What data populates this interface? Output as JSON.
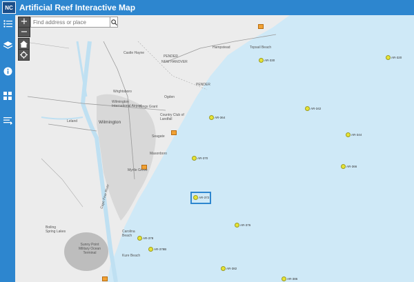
{
  "app": {
    "title": "Artificial Reef Interactive Map",
    "logo_text": "NC"
  },
  "search": {
    "placeholder": "Find address or place"
  },
  "zoom": {
    "in_label": "+",
    "out_label": "−"
  },
  "sidebar": {
    "items": [
      {
        "name": "legend-list-icon"
      },
      {
        "name": "layers-icon"
      },
      {
        "name": "info-icon"
      },
      {
        "name": "basemap-grid-icon"
      },
      {
        "name": "details-list-icon"
      }
    ]
  },
  "places": [
    {
      "label": "Castle Hayne"
    },
    {
      "label": "PENDER"
    },
    {
      "label": "NEW HANOVER"
    },
    {
      "label": "Hampstead"
    },
    {
      "label": "Topsail Beach"
    },
    {
      "label": "PENDER"
    },
    {
      "label": "Wrightsboro"
    },
    {
      "label": "Wilmington International Airport"
    },
    {
      "label": "Kings Grant"
    },
    {
      "label": "Ogden"
    },
    {
      "label": "Country Club of Landfall"
    },
    {
      "label": "Leland"
    },
    {
      "label": "Wilmington"
    },
    {
      "label": "Seagate"
    },
    {
      "label": "Masonboro"
    },
    {
      "label": "Myrtle Grove"
    },
    {
      "label": "Carolina Beach"
    },
    {
      "label": "Boiling Spring Lakes"
    },
    {
      "label": "Sunny Point Military Ocean Terminal"
    },
    {
      "label": "Kure Beach"
    },
    {
      "label": "Cape Fear River"
    }
  ],
  "reefs": [
    {
      "label": "AR-320"
    },
    {
      "label": "AR-330"
    },
    {
      "label": "AR-342"
    },
    {
      "label": "AR-344"
    },
    {
      "label": "AR-364"
    },
    {
      "label": "AR-366"
    },
    {
      "label": "AR-370"
    },
    {
      "label": "AR-372"
    },
    {
      "label": "AR-376"
    },
    {
      "label": "AR-378"
    },
    {
      "label": "AR-378B"
    },
    {
      "label": "AR-382"
    },
    {
      "label": "AR-386"
    }
  ],
  "colors": {
    "header": "#2d86cf",
    "ocean": "#cfe9f7",
    "land": "#ececec",
    "reef_marker": "#e6e335",
    "selection": "#2d86cf"
  }
}
